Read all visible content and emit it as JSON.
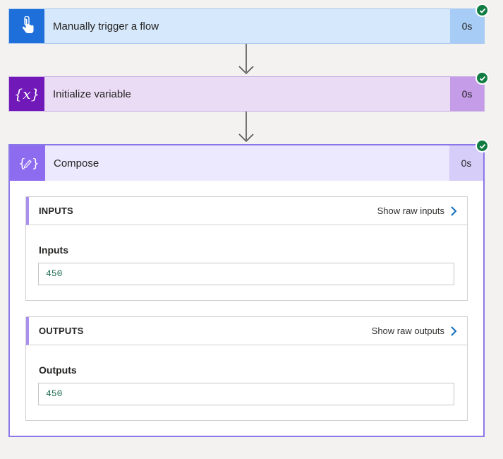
{
  "steps": [
    {
      "title": "Manually trigger a flow",
      "duration": "0s",
      "icon": "touch-hand-icon",
      "status": "succeeded",
      "color": "#1e6fd9"
    },
    {
      "title": "Initialize variable",
      "duration": "0s",
      "icon": "variable-icon",
      "status": "succeeded",
      "color": "#7019b8"
    },
    {
      "title": "Compose",
      "duration": "0s",
      "icon": "compose-icon",
      "status": "succeeded",
      "color": "#8e6cf0"
    }
  ],
  "compose": {
    "inputs": {
      "heading": "INPUTS",
      "raw_link": "Show raw inputs",
      "field_label": "Inputs",
      "value": "450"
    },
    "outputs": {
      "heading": "OUTPUTS",
      "raw_link": "Show raw outputs",
      "field_label": "Outputs",
      "value": "450"
    }
  },
  "colors": {
    "success": "#107c41",
    "link_chevron": "#0f6cbd",
    "value_text": "#1c6b54"
  }
}
